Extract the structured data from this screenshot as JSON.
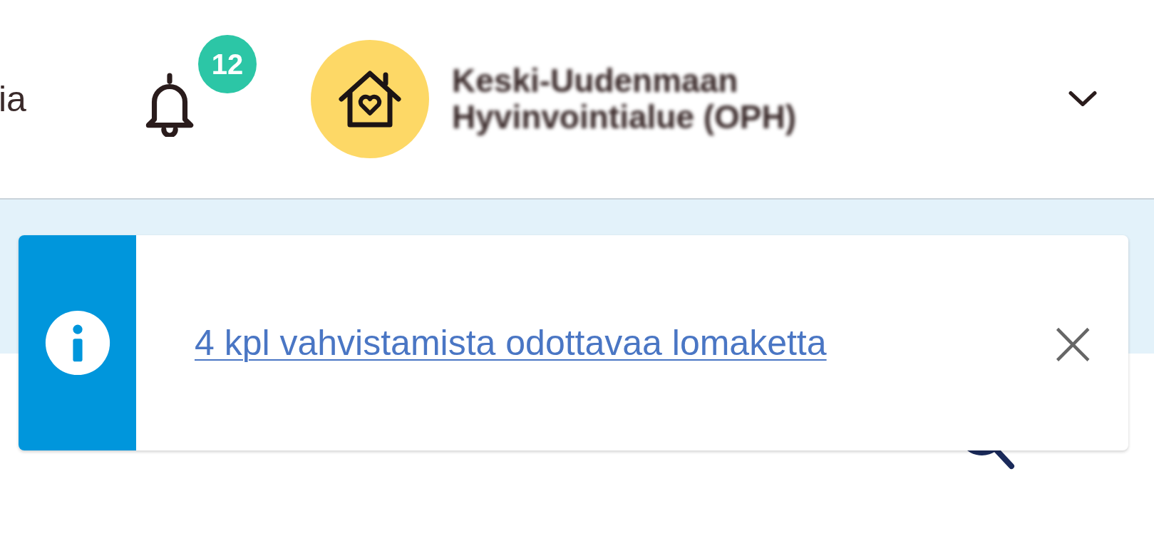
{
  "header": {
    "nav_item": "ia",
    "notifications": {
      "count": "12"
    },
    "organization": {
      "name": "Keski-Uudenmaan Hyvinvointialue (OPH)"
    }
  },
  "notice": {
    "link": "4 kpl vahvistamista odottavaa lomaketta",
    "close": "×"
  }
}
